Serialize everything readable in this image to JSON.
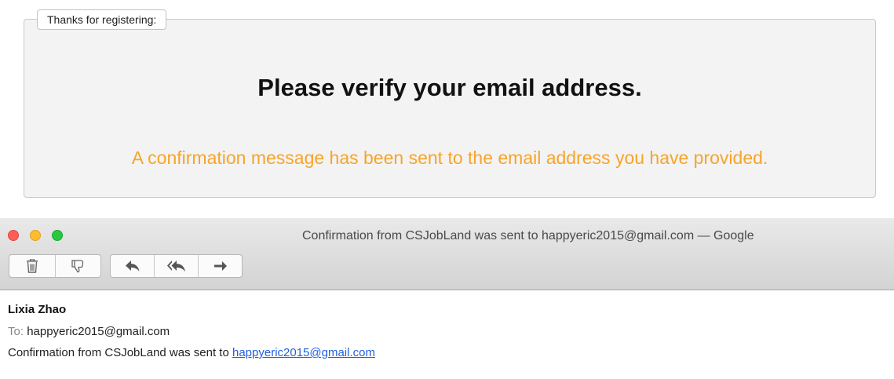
{
  "registration": {
    "legend": "Thanks for registering:",
    "heading": "Please verify your email address.",
    "message": "A confirmation message has been sent to the email address you have provided.",
    "message_color": "#f7a429"
  },
  "mail_window": {
    "title": "Confirmation from CSJobLand was sent to happyeric2015@gmail.com — Google",
    "toolbar": {
      "buttons": [
        "trash-icon",
        "junk-icon",
        "reply-icon",
        "reply-all-icon",
        "forward-icon"
      ]
    }
  },
  "message": {
    "sender": "Lixia Zhao",
    "to_label": "To:",
    "to_address": "happyeric2015@gmail.com",
    "body_text": "Confirmation from CSJobLand was sent to",
    "body_link": "happyeric2015@gmail.com",
    "link_color": "#1f5fe0"
  }
}
